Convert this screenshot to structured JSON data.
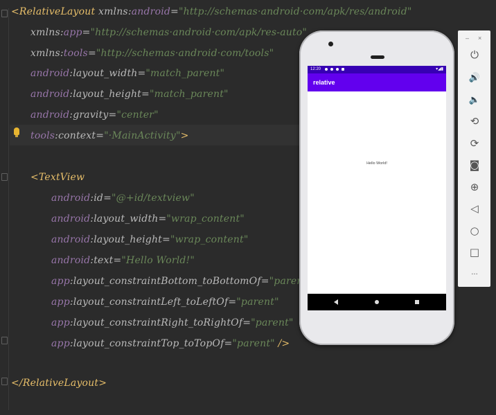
{
  "editor": {
    "lines": [
      {
        "tag": "<RelativeLayout",
        "sp": " ",
        "ns": "xmlns:",
        "attr": "android",
        "eq": "=",
        "val": "\"http://schemas·android·com/apk/res/android\""
      },
      {
        "ns": "xmlns:",
        "attr": "app",
        "eq": "=",
        "val": "\"http://schemas·android·com/apk/res-auto\""
      },
      {
        "ns": "xmlns:",
        "attr": "tools",
        "eq": "=",
        "val": "\"http://schemas·android·com/tools\""
      },
      {
        "ns": "android",
        "attr": ":layout_width",
        "eq": "=",
        "val": "\"match_parent\""
      },
      {
        "ns": "android",
        "attr": ":layout_height",
        "eq": "=",
        "val": "\"match_parent\""
      },
      {
        "ns": "android",
        "attr": ":gravity",
        "eq": "=",
        "val": "\"center\""
      },
      {
        "ns": "tools",
        "attr": ":context",
        "eq": "=",
        "val": "\"·MainActivity\"",
        "end": ">"
      },
      {
        "tag": "<TextView"
      },
      {
        "ns": "android",
        "attr": ":id",
        "eq": "=",
        "val": "\"@+id/textview\""
      },
      {
        "ns": "android",
        "attr": ":layout_width",
        "eq": "=",
        "val": "\"wrap_content\""
      },
      {
        "ns": "android",
        "attr": ":layout_height",
        "eq": "=",
        "val": "\"wrap_content\""
      },
      {
        "ns": "android",
        "attr": ":text",
        "eq": "=",
        "val": "\"Hello World!\""
      },
      {
        "ns": "app",
        "attr": ":layout_constraintBottom_toBottomOf",
        "eq": "=",
        "val": "\"parent\""
      },
      {
        "ns": "app",
        "attr": ":layout_constraintLeft_toLeftOf",
        "eq": "=",
        "val": "\"parent\""
      },
      {
        "ns": "app",
        "attr": ":layout_constraintRight_toRightOf",
        "eq": "=",
        "val": "\"parent\""
      },
      {
        "ns": "app",
        "attr": ":layout_constraintTop_toTopOf",
        "eq": "=",
        "val": "\"parent\"",
        "end": " />"
      },
      {
        "tag": "</RelativeLayout>"
      }
    ],
    "icons": {
      "bulb": "lightbulb-icon",
      "fold": "fold-marker-icon"
    }
  },
  "emulator": {
    "status_time": "12:20",
    "app_title": "relative",
    "screen_text": "Hello World!",
    "colors": {
      "status_bar": "#3700b3",
      "app_bar": "#6200ee"
    },
    "nav_icons": [
      "back-icon",
      "home-icon",
      "recents-icon"
    ]
  },
  "toolbar": {
    "minimize": "–",
    "close": "×",
    "buttons": [
      {
        "name": "power-icon",
        "glyph": "⏻"
      },
      {
        "name": "volume-up-icon",
        "glyph": "🔊"
      },
      {
        "name": "volume-down-icon",
        "glyph": "🔈"
      },
      {
        "name": "rotate-left-icon",
        "glyph": "⟲"
      },
      {
        "name": "rotate-right-icon",
        "glyph": "⟳"
      },
      {
        "name": "screenshot-icon",
        "glyph": "◙"
      },
      {
        "name": "zoom-icon",
        "glyph": "⊕"
      },
      {
        "name": "back-icon",
        "glyph": "◁"
      },
      {
        "name": "home-icon",
        "glyph": "○"
      },
      {
        "name": "overview-icon",
        "glyph": "□"
      },
      {
        "name": "more-icon",
        "glyph": "···"
      }
    ]
  }
}
